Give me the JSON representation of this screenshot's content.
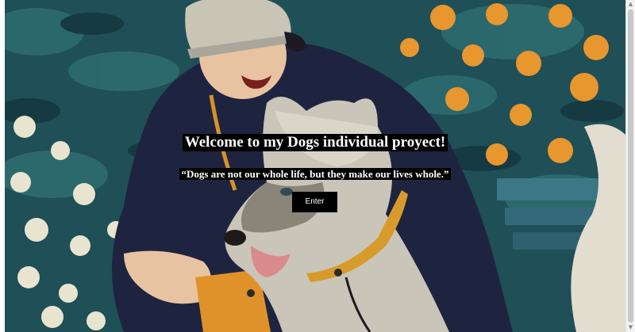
{
  "hero": {
    "title": "Welcome to my Dogs individual proyect!",
    "quote": "“Dogs are not our whole life, but they make our lives whole.”",
    "enter_label": "Enter"
  },
  "colors": {
    "background_teal": "#1f4f57",
    "flower_orange": "#e8962e",
    "flower_white": "#e9e4cf",
    "jacket_navy": "#1e2440",
    "dog_grey": "#c9c5b8",
    "phone_orange": "#e0922a",
    "text_background": "#000000",
    "text_color": "#ffffff"
  }
}
